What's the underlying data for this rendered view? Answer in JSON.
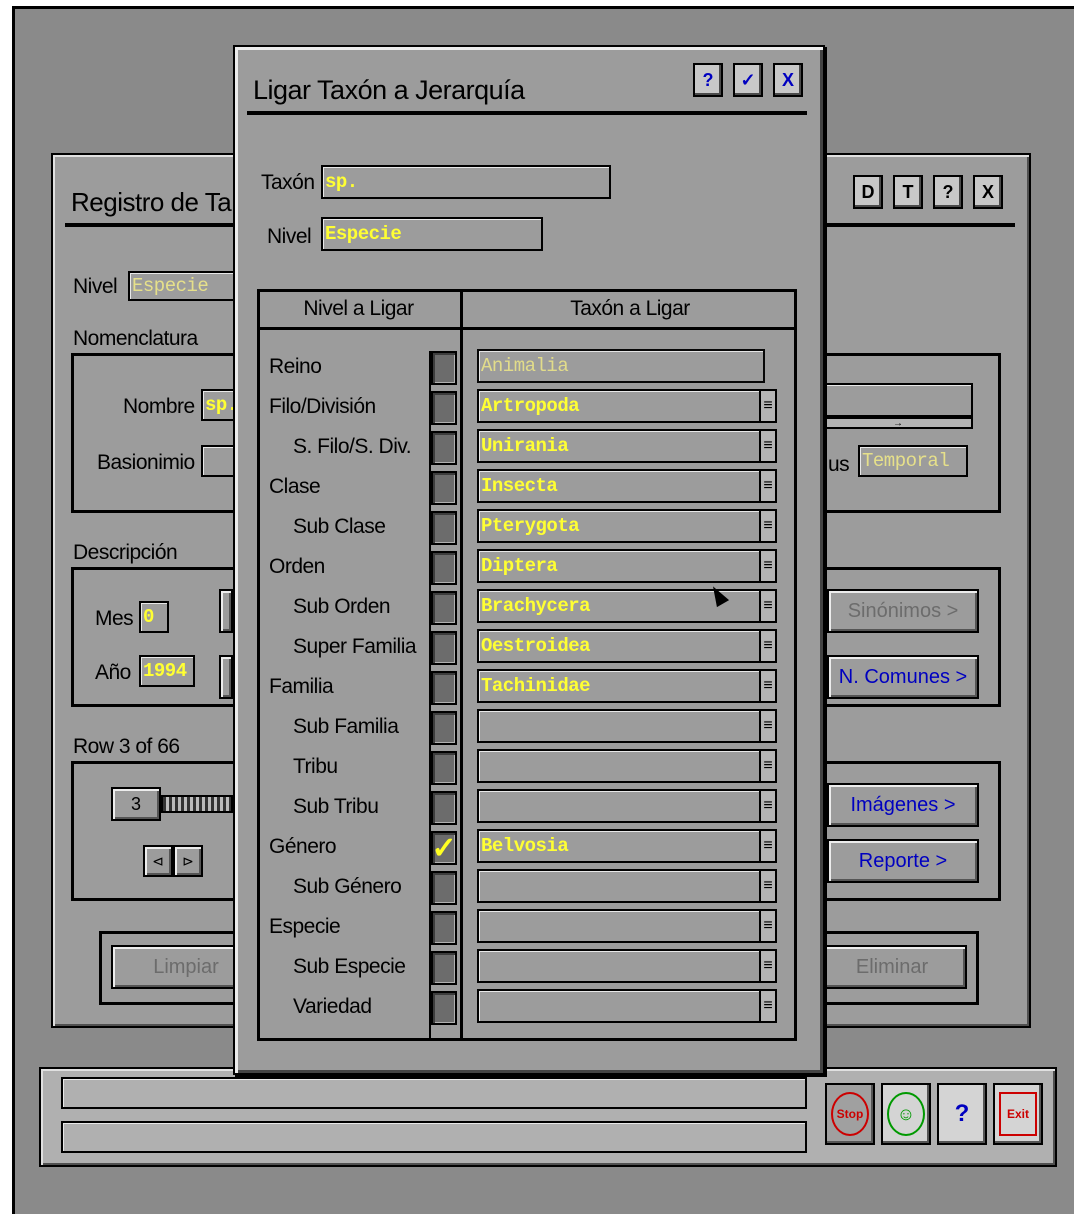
{
  "back_window": {
    "title": "Registro de Ta",
    "toolbar": [
      "D",
      "T",
      "?",
      "X"
    ],
    "nivel_label": "Nivel",
    "nivel_value": "Especie",
    "nomenclatura_label": "Nomenclatura",
    "nombre_label": "Nombre",
    "nombre_value": "sp.",
    "basionimio_label": "Basionimio",
    "status_label": "us",
    "status_value": "Temporal",
    "descripcion_label": "Descripción",
    "mes_label": "Mes",
    "mes_value": "0",
    "anio_label": "Año",
    "anio_value": "1994",
    "sinonimos_button": "Sinónimos >",
    "comunes_button": "N. Comunes >",
    "row_label": "Row 3 of 66",
    "row_counter": "3",
    "imagenes_button": "Imágenes >",
    "reporte_button": "Reporte >",
    "limpiar_button": "Limpiar",
    "eliminar_button": "Eliminar"
  },
  "dialog": {
    "title": "Ligar Taxón a Jerarquía",
    "toolbar": [
      "?",
      "✓",
      "X"
    ],
    "taxon_label": "Taxón",
    "taxon_value": "sp.",
    "nivel_label": "Nivel",
    "nivel_value": "Especie",
    "col_nivel": "Nivel a Ligar",
    "col_taxon": "Taxón a Ligar",
    "rows": [
      {
        "level": "Reino",
        "taxon": "Animalia",
        "checked": false
      },
      {
        "level": "Filo/División",
        "taxon": "Artropoda",
        "checked": false
      },
      {
        "level": "S. Filo/S. Div.",
        "taxon": "Unirania",
        "checked": false
      },
      {
        "level": "Clase",
        "taxon": "Insecta",
        "checked": false
      },
      {
        "level": "Sub Clase",
        "taxon": "Pterygota",
        "checked": false
      },
      {
        "level": "Orden",
        "taxon": "Diptera",
        "checked": false
      },
      {
        "level": "Sub Orden",
        "taxon": "Brachycera",
        "checked": false
      },
      {
        "level": "Super Familia",
        "taxon": "Oestroidea",
        "checked": false
      },
      {
        "level": "Familia",
        "taxon": "Tachinidae",
        "checked": false
      },
      {
        "level": "Sub Familia",
        "taxon": "",
        "checked": false
      },
      {
        "level": "Tribu",
        "taxon": "",
        "checked": false
      },
      {
        "level": "Sub Tribu",
        "taxon": "",
        "checked": false
      },
      {
        "level": "Género",
        "taxon": "Belvosia",
        "checked": true
      },
      {
        "level": "Sub Género",
        "taxon": "",
        "checked": false
      },
      {
        "level": "Especie",
        "taxon": "",
        "checked": false
      },
      {
        "level": "Sub Especie",
        "taxon": "",
        "checked": false
      },
      {
        "level": "Variedad",
        "taxon": "",
        "checked": false
      }
    ]
  },
  "bottom_bar": {
    "stop_icon": "stop-icon",
    "ok_icon": "smiley-icon",
    "help_icon": "help-icon",
    "exit_icon": "exit-icon",
    "stop_text": "Stop",
    "exit_text": "Exit"
  }
}
